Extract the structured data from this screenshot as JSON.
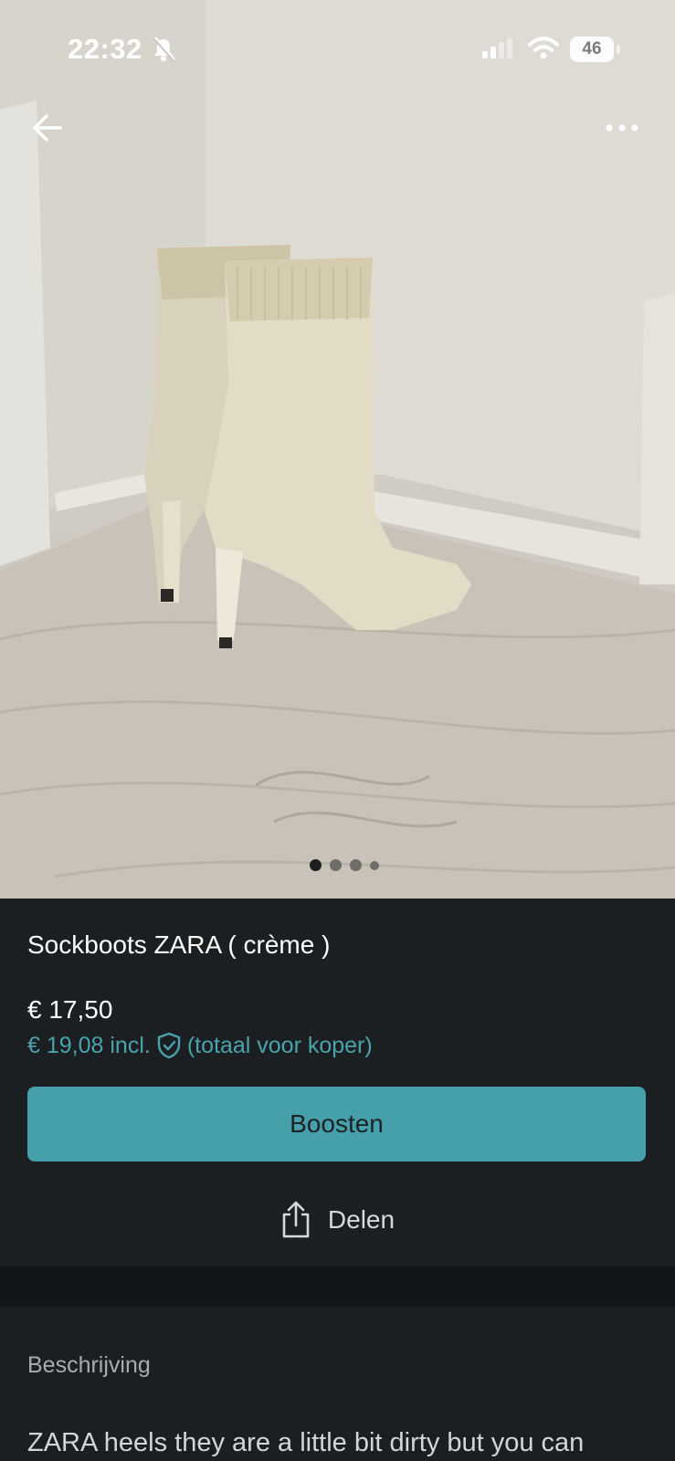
{
  "status_bar": {
    "time": "22:32",
    "battery": "46",
    "icons": [
      "bell-slash-icon",
      "signal-icon",
      "wifi-icon",
      "battery-icon"
    ]
  },
  "nav": {
    "back_icon": "arrow-left-icon",
    "more_icon": "more-horizontal-icon"
  },
  "gallery": {
    "image_count": 4,
    "active_index": 0
  },
  "listing": {
    "title": "Sockboots ZARA ( crème )",
    "price": "€ 17,50",
    "price_incl": "€ 19,08 incl.",
    "price_incl_note": "(totaal voor koper)",
    "boost_label": "Boosten",
    "share_label": "Delen"
  },
  "description": {
    "heading": "Beschrijving",
    "text": "ZARA heels they are a little bit dirty but you can"
  },
  "colors": {
    "accent": "#45a0ab",
    "price_incl": "#4aa3ad",
    "background": "#1b1f21"
  }
}
